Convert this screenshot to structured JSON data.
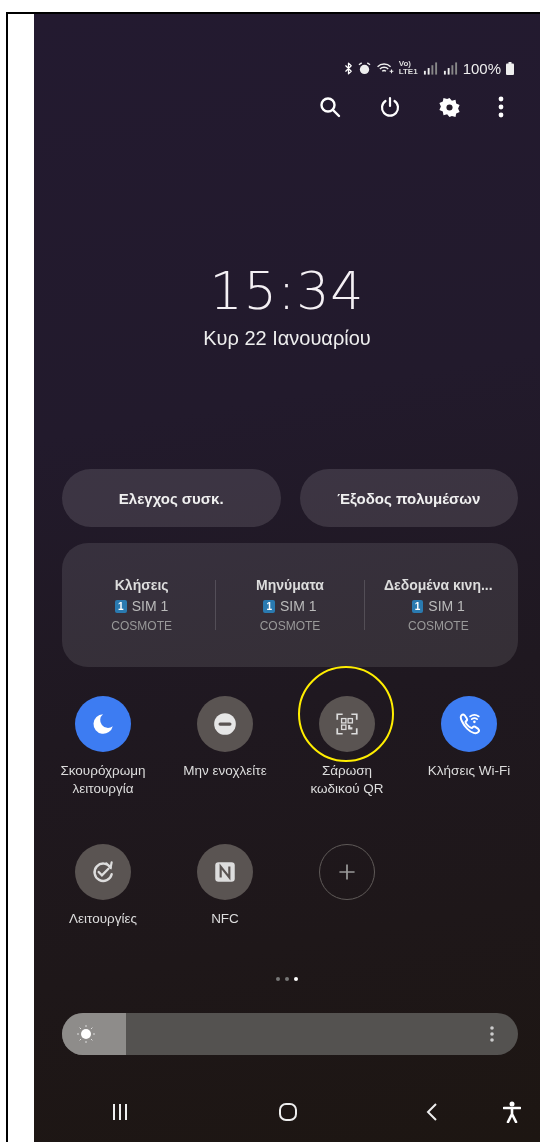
{
  "status_bar": {
    "volte_top": "Vo)",
    "volte_bottom": "LTE1",
    "battery": "100%"
  },
  "clock": {
    "time": "15:34",
    "date": "Κυρ 22 Ιανουαρίου"
  },
  "quick_buttons": [
    "Ελεγχος συσκ.",
    "Έξοδος πολυμέσων"
  ],
  "sim_card": [
    {
      "label": "Κλήσεις",
      "sim_badge": "1",
      "sim": "SIM 1",
      "carrier": "COSMOTE"
    },
    {
      "label": "Μηνύματα",
      "sim_badge": "1",
      "sim": "SIM 1",
      "carrier": "COSMOTE"
    },
    {
      "label": "Δεδομένα κινη...",
      "sim_badge": "1",
      "sim": "SIM 1",
      "carrier": "COSMOTE"
    }
  ],
  "tiles": [
    {
      "kind": "moon",
      "label": "Σκουρόχρωμη λειτουργία",
      "on": true,
      "highlighted": false
    },
    {
      "kind": "dnd",
      "label": "Μην ενοχλείτε",
      "on": false,
      "highlighted": false
    },
    {
      "kind": "qr",
      "label": "Σάρωση κωδικού QR",
      "on": false,
      "highlighted": true
    },
    {
      "kind": "wificall",
      "label": "Κλήσεις Wi-Fi",
      "on": true,
      "highlighted": false
    },
    {
      "kind": "routines",
      "label": "Λειτουργίες",
      "on": false,
      "highlighted": false
    },
    {
      "kind": "nfc",
      "label": "NFC",
      "on": false,
      "highlighted": false
    },
    {
      "kind": "add"
    }
  ],
  "pages": [
    {
      "selected": false
    },
    {
      "selected": false
    },
    {
      "selected": true
    }
  ],
  "brightness": {
    "level": 0.14
  }
}
